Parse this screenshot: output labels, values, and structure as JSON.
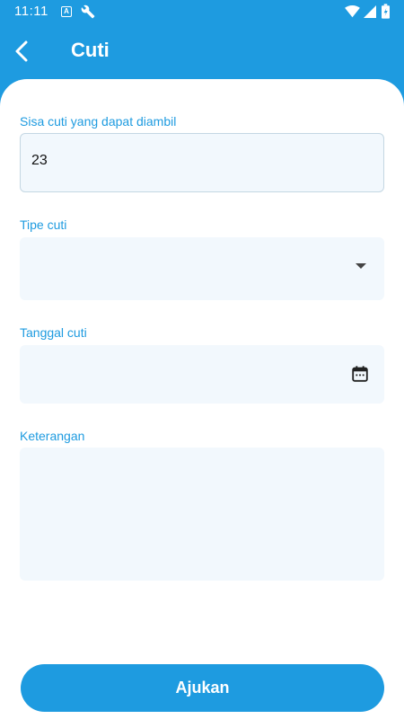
{
  "status_bar": {
    "time": "11:11",
    "a_icon_letter": "A",
    "icons": [
      "a-badge-icon",
      "wrench-icon",
      "wifi-icon",
      "signal-icon",
      "battery-icon"
    ]
  },
  "app_bar": {
    "title": "Cuti",
    "back_icon": "chevron-left-icon"
  },
  "form": {
    "remaining_leave": {
      "label": "Sisa cuti yang dapat diambil",
      "value": "23"
    },
    "leave_type": {
      "label": "Tipe cuti",
      "value": "",
      "icon": "dropdown-arrow-icon"
    },
    "leave_date": {
      "label": "Tanggal cuti",
      "value": "",
      "icon": "calendar-icon"
    },
    "notes": {
      "label": "Keterangan",
      "value": ""
    }
  },
  "submit": {
    "label": "Ajukan"
  },
  "colors": {
    "primary": "#1e9be0",
    "field_background": "#f2f8fd",
    "surface": "#ffffff"
  }
}
